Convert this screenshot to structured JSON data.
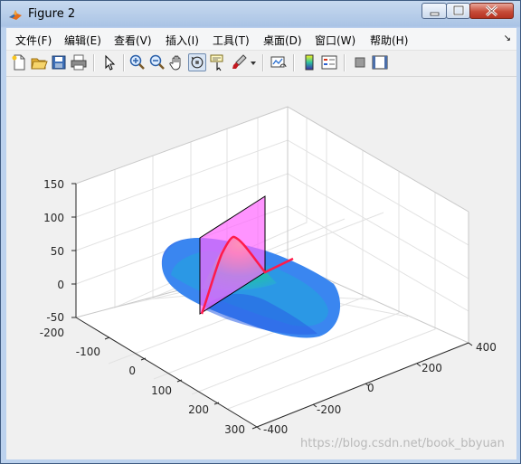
{
  "window": {
    "title": "Figure 2",
    "controls": {
      "minimize_icon": "minimize-icon",
      "maximize_icon": "maximize-icon",
      "close_icon": "close-icon"
    }
  },
  "menu": {
    "items": [
      {
        "label": "文件(F)"
      },
      {
        "label": "编辑(E)"
      },
      {
        "label": "查看(V)"
      },
      {
        "label": "插入(I)"
      },
      {
        "label": "工具(T)"
      },
      {
        "label": "桌面(D)"
      },
      {
        "label": "窗口(W)"
      },
      {
        "label": "帮助(H)"
      }
    ],
    "dock_arrow": "↘"
  },
  "toolbar": {
    "buttons": [
      "new-figure-icon",
      "open-file-icon",
      "save-icon",
      "print-icon",
      "edit-plot-arrow-icon",
      "zoom-in-icon",
      "zoom-out-icon",
      "pan-hand-icon",
      "rotate-3d-icon",
      "data-cursor-icon",
      "brush-icon",
      "brush-dropdown-icon",
      "link-plot-icon",
      "colorbar-icon",
      "legend-icon",
      "hide-plot-tools-icon",
      "show-plot-tools-icon"
    ],
    "active": "rotate-3d-icon"
  },
  "chart_data": {
    "type": "surface-3d",
    "title": "",
    "xlabel": "",
    "ylabel": "",
    "zlabel": "",
    "z_ticks": [
      "150",
      "100",
      "50",
      "0",
      "-50"
    ],
    "y_ticks": [
      "-200",
      "-100",
      "0",
      "100",
      "200",
      "300"
    ],
    "x_ticks": [
      "-400",
      "-200",
      "0",
      "200",
      "400"
    ],
    "zlim": [
      -50,
      150
    ],
    "ylim": [
      -200,
      300
    ],
    "xlim": [
      -400,
      400
    ],
    "grid": true,
    "colormap": "parula",
    "peak_z": 70,
    "slice_plane_color": "#ff66ff",
    "profile_line_color": "#ff1a4a"
  },
  "watermark": "https://blog.csdn.net/book_bbyuan"
}
